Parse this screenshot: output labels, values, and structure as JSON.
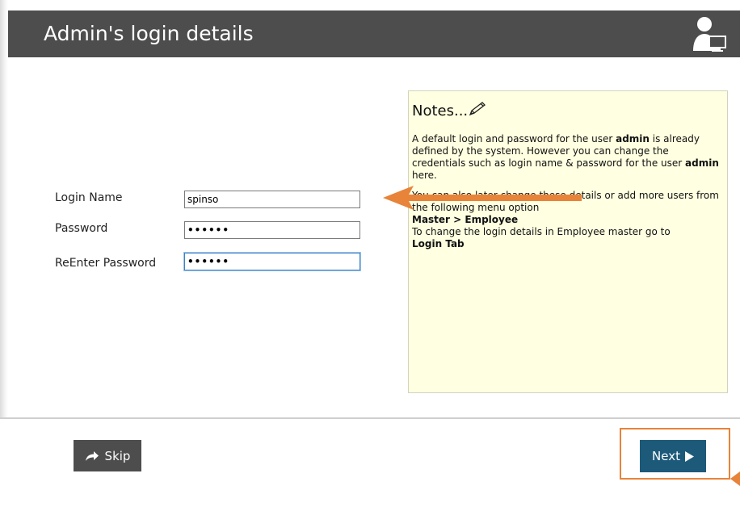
{
  "header": {
    "title": "Admin's login details",
    "icon": "user-computer-icon"
  },
  "form": {
    "login_name": {
      "label": "Login Name",
      "value": "spinso"
    },
    "password": {
      "label": "Password",
      "value": "••••••"
    },
    "reenter_password": {
      "label": "ReEnter Password",
      "value": "••••••"
    }
  },
  "notes": {
    "title": "Notes...",
    "icon": "pencil-icon",
    "p1_a": "A default login and password for the user ",
    "p1_admin1": "admin",
    "p1_b": " is already defined by the system. However you can change the credentials such as login name & password for the user ",
    "p1_admin2": "admin",
    "p1_c": " here.",
    "p2_a": "You can also later change these details or add more users  from the following menu option",
    "p2_menu": "Master > Employee",
    "p2_b": "To change the login details in Employee master go to",
    "p2_tab": "Login Tab"
  },
  "footer": {
    "skip_label": "Skip",
    "next_label": "Next"
  },
  "colors": {
    "header_bg": "#4d4d4d",
    "notes_bg": "#ffffe1",
    "next_bg": "#1d5a7a",
    "annotation": "#e8833a"
  }
}
